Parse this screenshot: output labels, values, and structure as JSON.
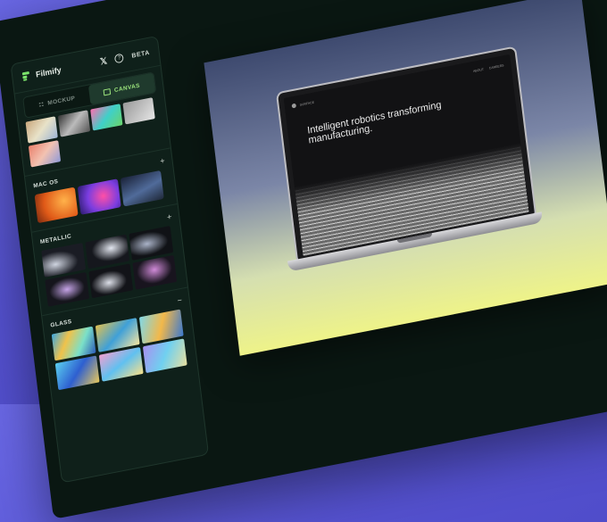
{
  "app": {
    "brand": "Filmify",
    "beta": "BETA"
  },
  "tabs": [
    {
      "label": "MOCKUP",
      "active": false
    },
    {
      "label": "CANVAS",
      "active": true
    }
  ],
  "sections": [
    {
      "title": "MAC OS",
      "action": "+"
    },
    {
      "title": "METALLIC",
      "action": "+"
    },
    {
      "title": "GLASS",
      "action": "−"
    }
  ],
  "icons": {
    "logo": "filmify-logo-icon",
    "x": "x-icon",
    "help": "help-icon",
    "mockup": "grid-icon",
    "canvas": "image-icon"
  },
  "screen": {
    "brand": "SURFACE",
    "links": [
      "ABOUT",
      "CAREERS"
    ],
    "headline": "Intelligent robotics transforming manufacturing."
  },
  "colors": {
    "accent": "#9be37c",
    "panel": "#0f201a",
    "backdrop": "#5552d0"
  }
}
